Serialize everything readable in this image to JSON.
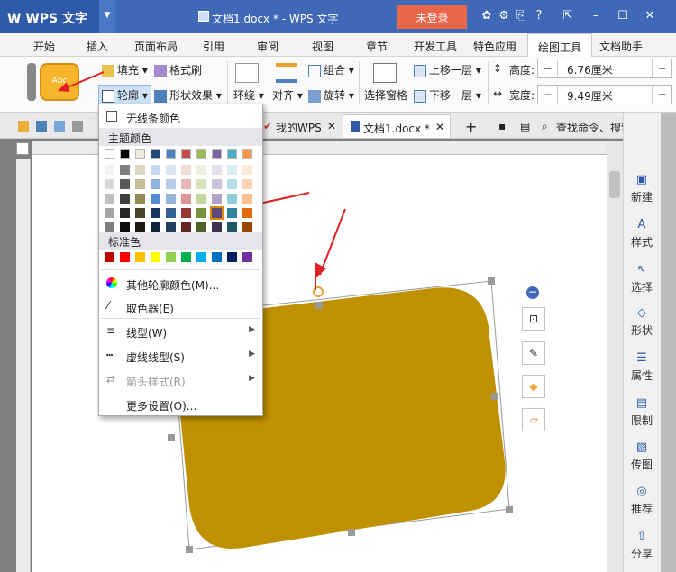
{
  "titlebar": {
    "app_name": "WPS 文字",
    "doc_title": "文档1.docx * - WPS 文字",
    "login_label": "未登录"
  },
  "menu_tabs": [
    "开始",
    "插入",
    "页面布局",
    "引用",
    "审阅",
    "视图",
    "章节",
    "开发工具",
    "特色应用",
    "绘图工具",
    "文档助手"
  ],
  "active_tab": "绘图工具",
  "ribbon": {
    "shape_preview_text": "Abc",
    "fill_label": "填充",
    "format_painter_label": "格式刷",
    "outline_label": "轮廓",
    "shape_effect_label": "形状效果",
    "wrap_label": "环绕",
    "align_label": "对齐",
    "group_label": "组合",
    "rotate_label": "旋转",
    "selection_pane_label": "选择窗格",
    "bring_forward_label": "上移一层",
    "send_backward_label": "下移一层",
    "height_label": "高度:",
    "height_value": "6.76厘米",
    "width_label": "宽度:",
    "width_value": "9.49厘米"
  },
  "doc_tabs": {
    "my_wps": "我的WPS",
    "doc_tab": "文档1.docx *",
    "search_label": "查找命令、搜索模板"
  },
  "right_pane": [
    "新建",
    "样式",
    "选择",
    "形状",
    "属性",
    "限制",
    "传图",
    "推荐",
    "分享"
  ],
  "dropdown": {
    "no_line": "无线条颜色",
    "theme_colors_header": "主题颜色",
    "standard_colors_header": "标准色",
    "more_colors": "其他轮廓颜色(M)...",
    "eyedropper": "取色器(E)",
    "line_style": "线型(W)",
    "dash_style": "虚线线型(S)",
    "arrow_style": "箭头样式(R)",
    "more_settings": "更多设置(O)..."
  },
  "colors": {
    "theme_row": [
      "#ffffff",
      "#000000",
      "#eeece1",
      "#1f497d",
      "#4f81bd",
      "#c0504d",
      "#9bbb59",
      "#8064a2",
      "#4bacc6",
      "#f79646"
    ],
    "theme_grid": [
      [
        "#f2f2f2",
        "#7f7f7f",
        "#ddd9c3",
        "#c6d9f0",
        "#dbe5f1",
        "#f2dcdb",
        "#ebf1dd",
        "#e5e0ec",
        "#dbeef3",
        "#fdeada"
      ],
      [
        "#d8d8d8",
        "#595959",
        "#c4bd97",
        "#8db3e2",
        "#b8cce4",
        "#e5b9b7",
        "#d7e3bc",
        "#ccc1d9",
        "#b7dde8",
        "#fbd5b5"
      ],
      [
        "#bfbfbf",
        "#3f3f3f",
        "#938953",
        "#548dd4",
        "#95b3d7",
        "#d99694",
        "#c3d69b",
        "#b2a2c7",
        "#92cddc",
        "#fac08f"
      ],
      [
        "#a5a5a5",
        "#262626",
        "#494429",
        "#17365d",
        "#366092",
        "#953734",
        "#76923c",
        "#5f497a",
        "#31859b",
        "#e36c09"
      ],
      [
        "#7f7f7f",
        "#0c0c0c",
        "#1d1b10",
        "#0f243e",
        "#244061",
        "#632423",
        "#4f6128",
        "#3f3151",
        "#205867",
        "#974806"
      ]
    ],
    "standard": [
      "#c00000",
      "#ff0000",
      "#ffc000",
      "#ffff00",
      "#92d050",
      "#00b050",
      "#00b0f0",
      "#0070c0",
      "#002060",
      "#7030a0"
    ],
    "shape_fill": "#bf9000",
    "accent": "#3f69b7"
  }
}
